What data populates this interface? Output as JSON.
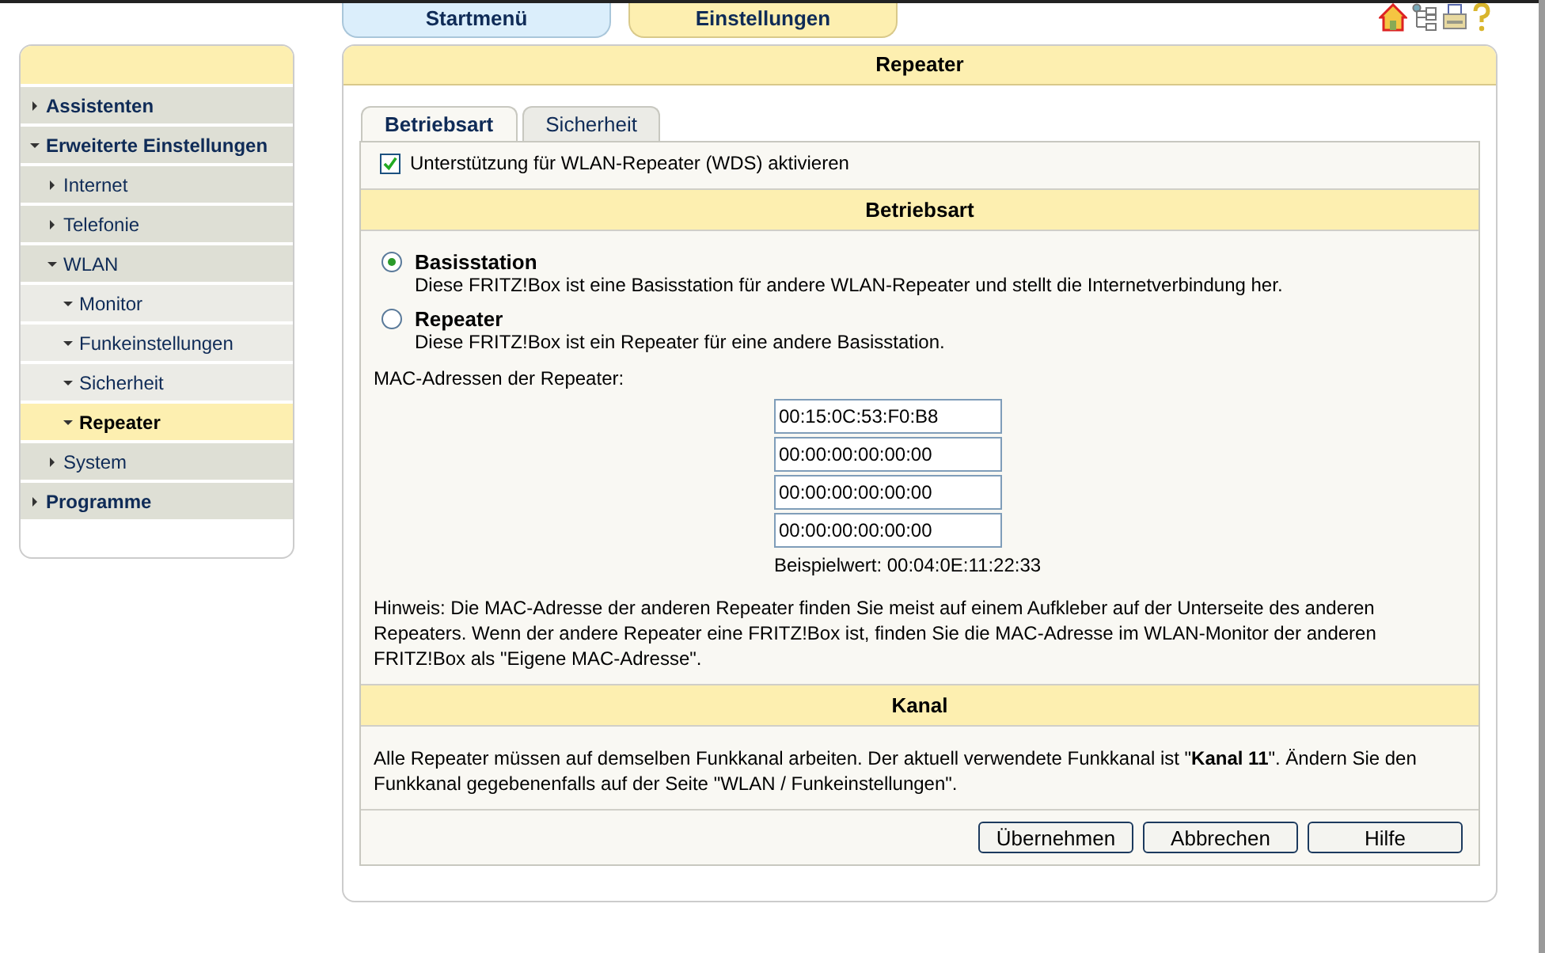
{
  "top_tabs": [
    {
      "label": "Startmenü",
      "selected": false
    },
    {
      "label": "Einstellungen",
      "selected": true
    }
  ],
  "sidebar": {
    "items": [
      {
        "label": "Assistenten",
        "expanded": false,
        "selected": false
      },
      {
        "label": "Erweiterte Einstellungen",
        "expanded": true,
        "selected": false,
        "children": [
          {
            "label": "Internet",
            "expanded": false,
            "selected": false
          },
          {
            "label": "Telefonie",
            "expanded": false,
            "selected": false
          },
          {
            "label": "WLAN",
            "expanded": true,
            "selected": false,
            "children": [
              {
                "label": "Monitor",
                "expanded": true,
                "selected": false
              },
              {
                "label": "Funkeinstellungen",
                "expanded": true,
                "selected": false
              },
              {
                "label": "Sicherheit",
                "expanded": true,
                "selected": false
              },
              {
                "label": "Repeater",
                "expanded": true,
                "selected": true
              }
            ]
          },
          {
            "label": "System",
            "expanded": false,
            "selected": false
          }
        ]
      },
      {
        "label": "Programme",
        "expanded": false,
        "selected": false
      }
    ]
  },
  "panel": {
    "title": "Repeater",
    "tabs": [
      {
        "label": "Betriebsart",
        "selected": true
      },
      {
        "label": "Sicherheit",
        "selected": false
      }
    ],
    "wds_checkbox": {
      "label": "Unterstützung für WLAN-Repeater (WDS) aktivieren",
      "checked": true
    },
    "mode_section": {
      "title": "Betriebsart",
      "options": [
        {
          "label": "Basisstation",
          "description": "Diese FRITZ!Box ist eine Basisstation für andere WLAN-Repeater und stellt die Internetverbindung her.",
          "selected": true
        },
        {
          "label": "Repeater",
          "description": "Diese FRITZ!Box ist ein Repeater für eine andere Basisstation.",
          "selected": false
        }
      ],
      "mac_label": "MAC-Adressen der Repeater:",
      "mac_fields": [
        "00:15:0C:53:F0:B8",
        "00:00:00:00:00:00",
        "00:00:00:00:00:00",
        "00:00:00:00:00:00"
      ],
      "example": "Beispielwert: 00:04:0E:11:22:33",
      "hint": "Hinweis: Die MAC-Adresse der anderen Repeater finden Sie meist auf einem Aufkleber auf der Unterseite des anderen Repeaters. Wenn der andere Repeater eine FRITZ!Box ist, finden Sie die MAC-Adresse im WLAN-Monitor der anderen FRITZ!Box als \"Eigene MAC-Adresse\"."
    },
    "channel_section": {
      "title": "Kanal",
      "text": "Alle Repeater müssen auf demselben Funkkanal arbeiten. Der aktuell verwendete Funkkanal ist \"**Kanal 11**\". Ändern Sie den Funkkanal gegebenenfalls auf der Seite \"WLAN / Funkeinstellungen\"."
    },
    "buttons": [
      "Übernehmen",
      "Abbrechen",
      "Hilfe"
    ]
  }
}
